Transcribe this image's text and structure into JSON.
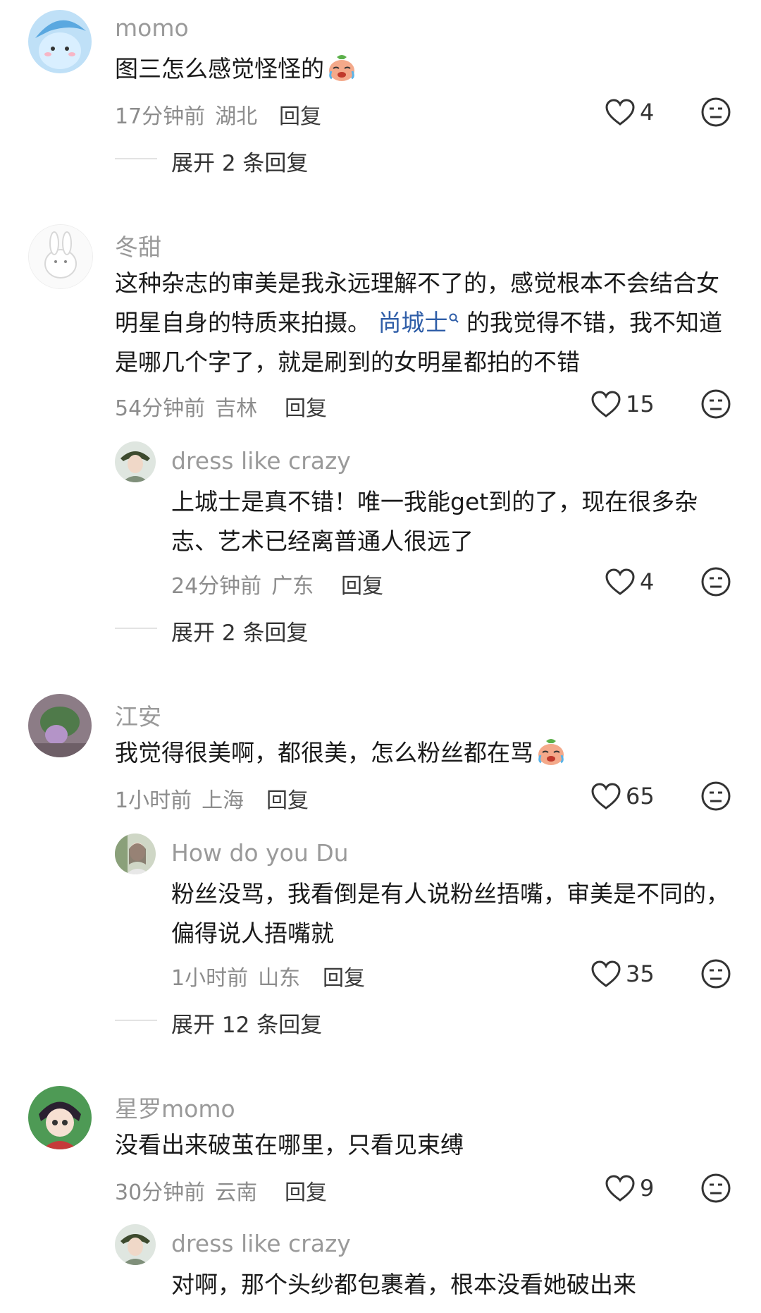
{
  "comments": [
    {
      "username": "momo",
      "text": "图三怎么感觉怪怪的",
      "emoji": "crying-face-emoji",
      "time": "17分钟前",
      "location": "湖北",
      "reply_label": "回复",
      "likes": "4",
      "expand": "展开 2 条回复"
    },
    {
      "username": "冬甜",
      "text_before": "这种杂志的审美是我永远理解不了的，感觉根本不会结合女明星自身的特质来拍摄。",
      "mention": "尚城士",
      "text_after": "的我觉得不错，我不知道是哪几个字了，就是刷到的女明星都拍的不错",
      "time": "54分钟前",
      "location": "吉林",
      "reply_label": "回复",
      "likes": "15",
      "replies": [
        {
          "username": "dress like crazy",
          "text": "上城士是真不错！唯一我能get到的了，现在很多杂志、艺术已经离普通人很远了",
          "time": "24分钟前",
          "location": "广东",
          "reply_label": "回复",
          "likes": "4"
        }
      ],
      "expand": "展开 2 条回复"
    },
    {
      "username": "江安",
      "text": "我觉得很美啊，都很美，怎么粉丝都在骂",
      "emoji": "crying-face-emoji",
      "time": "1小时前",
      "location": "上海",
      "reply_label": "回复",
      "likes": "65",
      "replies": [
        {
          "username": "How do you Du",
          "text": "粉丝没骂，我看倒是有人说粉丝捂嘴，审美是不同的，偏得说人捂嘴就",
          "time": "1小时前",
          "location": "山东",
          "reply_label": "回复",
          "likes": "35"
        }
      ],
      "expand": "展开 12 条回复"
    },
    {
      "username": "星罗momo",
      "text": "没看出来破茧在哪里，只看见束缚",
      "time": "30分钟前",
      "location": "云南",
      "reply_label": "回复",
      "likes": "9",
      "replies": [
        {
          "username": "dress like crazy",
          "text": "对啊，那个头纱都包裹着，根本没看她破出来"
        }
      ]
    }
  ],
  "colors": {
    "mention": "#2f5ea8",
    "username": "#9a9a9a",
    "meta": "#8c8c8c"
  }
}
